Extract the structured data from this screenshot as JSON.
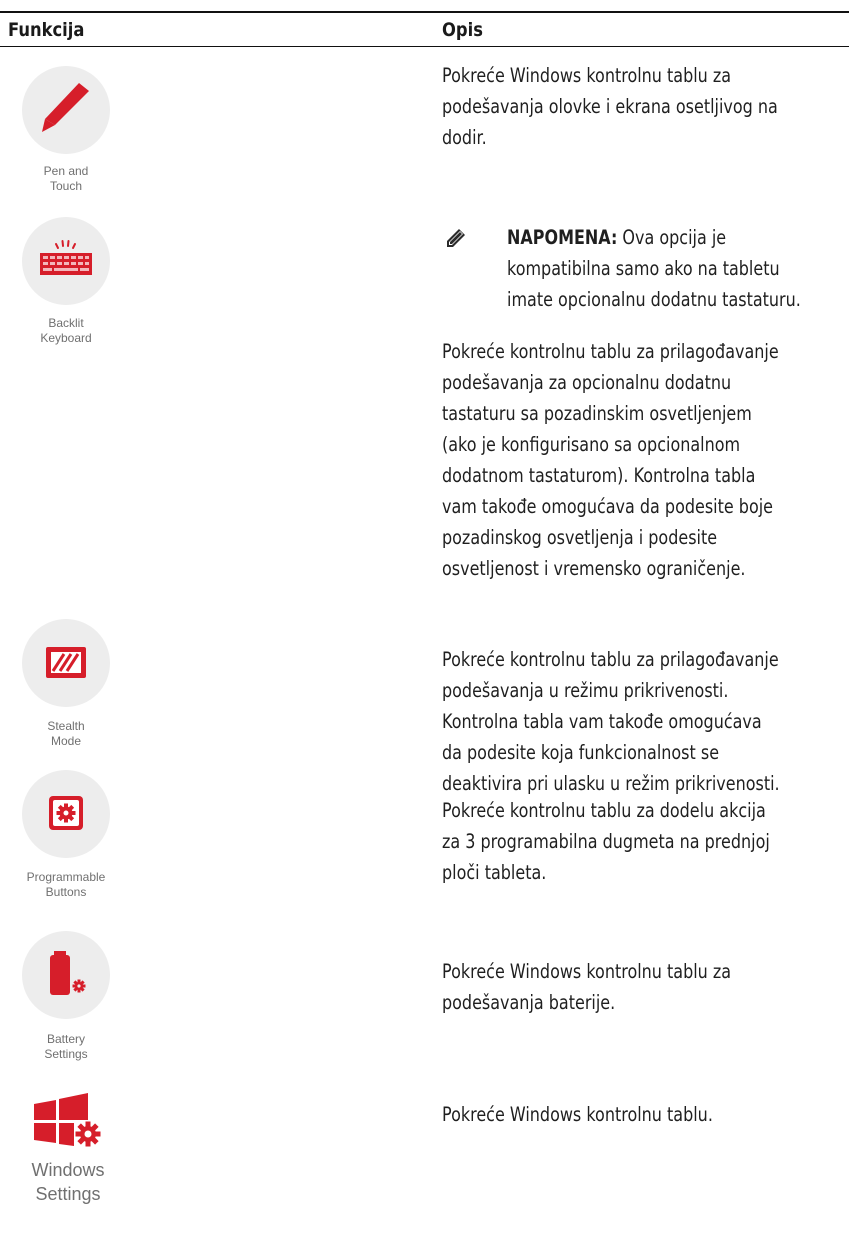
{
  "header": {
    "col1": "Funkcija",
    "col2": "Opis"
  },
  "rows": [
    {
      "caption": [
        "Pen and",
        "Touch"
      ],
      "desc": [
        "Pokreće Windows kontrolnu tablu za",
        "podešavanja olovke i ekrana osetljivog na",
        "dodir."
      ]
    },
    {
      "caption": [
        "Backlit",
        "Keyboard"
      ],
      "note_label": "NAPOMENA:",
      "note_first": " Ova opcija je",
      "note": [
        "kompatibilna samo ako na tabletu",
        "imate opcionalnu dodatnu tastaturu."
      ],
      "desc": [
        "Pokreće kontrolnu tablu za prilagođavanje",
        "podešavanja za opcionalnu dodatnu",
        "tastaturu sa pozadinskim osvetljenjem",
        "(ako je konfigurisano sa opcionalnom",
        "dodatnom tastaturom). Kontrolna tabla",
        "vam takođe omogućava da podesite boje",
        "pozadinskog osvetljenja i podesite",
        "osvetljenost i vremensko ograničenje."
      ]
    },
    {
      "caption": [
        "Stealth",
        "Mode"
      ],
      "desc": [
        "Pokreće kontrolnu tablu za prilagođavanje",
        "podešavanja u režimu prikrivenosti.",
        "Kontrolna tabla vam takođe omogućava",
        "da podesite koja funkcionalnost se",
        "deaktivira pri ulasku u režim prikrivenosti."
      ]
    },
    {
      "caption": [
        "Programmable",
        "Buttons"
      ],
      "desc": [
        "Pokreće kontrolnu tablu za dodelu akcija",
        "za 3 programabilna dugmeta na prednjoj",
        "ploči tableta."
      ]
    },
    {
      "caption": [
        "Battery",
        "Settings"
      ],
      "desc": [
        "Pokreće Windows kontrolnu tablu za",
        "podešavanja baterije."
      ]
    },
    {
      "caption": [
        "Windows",
        "Settings"
      ],
      "desc": [
        "Pokreće Windows kontrolnu tablu."
      ]
    }
  ]
}
